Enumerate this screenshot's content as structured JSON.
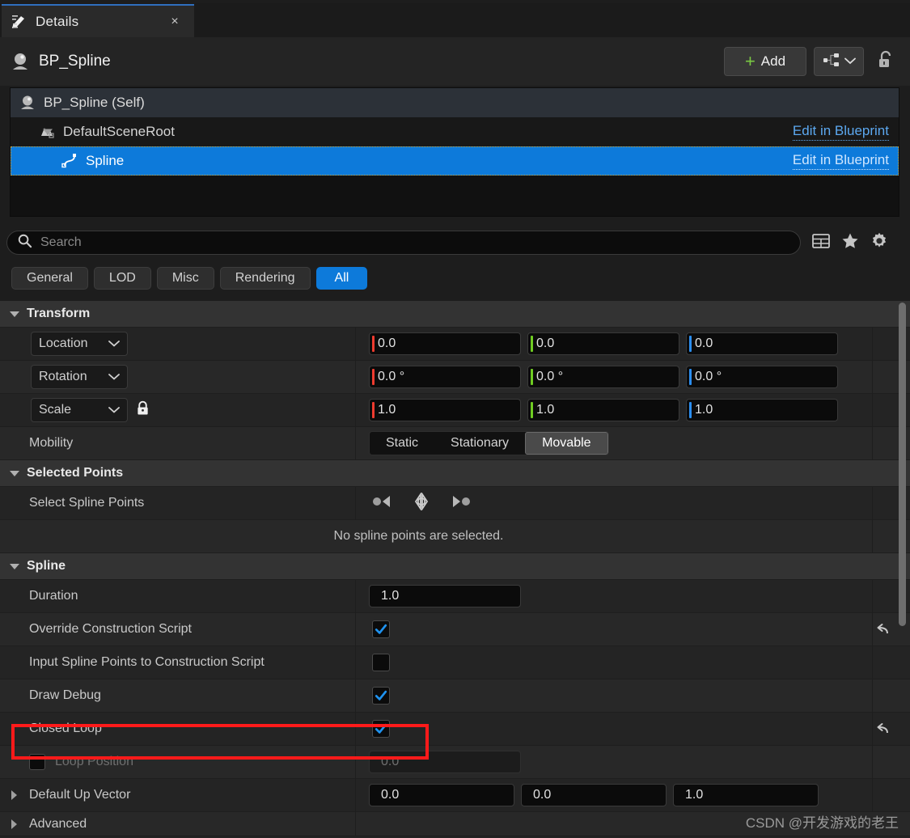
{
  "tab": {
    "label": "Details",
    "icon": "details-pencil-icon",
    "close": "×"
  },
  "header": {
    "object_name": "BP_Spline",
    "add_label": "Add",
    "add_icon": "plus-icon",
    "components_icon": "component-tree-icon",
    "chevron_icon": "chevron-down-icon",
    "lock_icon": "unlock-icon"
  },
  "tree": {
    "rows": [
      {
        "label": "BP_Spline (Self)",
        "icon": "blueprint-actor-icon",
        "indent": 0,
        "selected": false,
        "link": ""
      },
      {
        "label": "DefaultSceneRoot",
        "icon": "scene-root-icon",
        "indent": 1,
        "selected": false,
        "link": "Edit in Blueprint"
      },
      {
        "label": "Spline",
        "icon": "spline-icon",
        "indent": 2,
        "selected": true,
        "link": "Edit in Blueprint"
      }
    ]
  },
  "search": {
    "placeholder": "Search",
    "icon": "search-icon",
    "tools": [
      "columns-icon",
      "star-icon",
      "gear-icon"
    ]
  },
  "filters": {
    "items": [
      {
        "label": "General",
        "active": false
      },
      {
        "label": "LOD",
        "active": false
      },
      {
        "label": "Misc",
        "active": false
      },
      {
        "label": "Rendering",
        "active": false
      },
      {
        "label": "All",
        "active": true
      }
    ]
  },
  "colors": {
    "axis_x": "#ee3b2f",
    "axis_y": "#6fcc22",
    "axis_z": "#2b8ef0",
    "accent": "#0d7ada",
    "highlight": "#ff1a1a"
  },
  "sections": {
    "transform": {
      "title": "Transform",
      "location": {
        "label": "Location",
        "x": "0.0",
        "y": "0.0",
        "z": "0.0"
      },
      "rotation": {
        "label": "Rotation",
        "x": "0.0 °",
        "y": "0.0 °",
        "z": "0.0 °"
      },
      "scale": {
        "label": "Scale",
        "x": "1.0",
        "y": "1.0",
        "z": "1.0",
        "lock_icon": "lock-icon"
      },
      "mobility": {
        "label": "Mobility",
        "options": [
          "Static",
          "Stationary",
          "Movable"
        ],
        "selected": "Movable"
      }
    },
    "selected_points": {
      "title": "Selected Points",
      "select_label": "Select Spline Points",
      "icons": [
        "select-prev-point-icon",
        "select-all-points-icon",
        "select-next-point-icon"
      ],
      "empty_note": "No spline points are selected."
    },
    "spline": {
      "title": "Spline",
      "duration": {
        "label": "Duration",
        "value": "1.0"
      },
      "override_construction_script": {
        "label": "Override Construction Script",
        "checked": true,
        "reset": true
      },
      "input_spline_points": {
        "label": "Input Spline Points to Construction Script",
        "checked": false,
        "reset": false
      },
      "draw_debug": {
        "label": "Draw Debug",
        "checked": true,
        "reset": false
      },
      "closed_loop": {
        "label": "Closed Loop",
        "checked": true,
        "reset": true,
        "highlighted": true
      },
      "loop_position": {
        "label": "Loop Position",
        "enabled": false,
        "value": "0.0"
      },
      "default_up_vector": {
        "label": "Default Up Vector",
        "x": "0.0",
        "y": "0.0",
        "z": "1.0"
      },
      "advanced": {
        "label": "Advanced"
      }
    }
  },
  "watermark": "CSDN @开发游戏的老王"
}
